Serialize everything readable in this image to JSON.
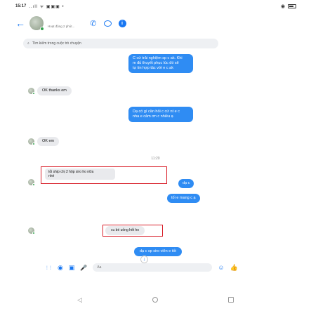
{
  "status_bar": {
    "time": "15:17",
    "signal": "..ıll ᯤ ▣▣▣ •"
  },
  "header": {
    "status": "Hoạt động 2 phút..."
  },
  "search": {
    "placeholder": "Tìm kiếm trong cuộc trò chuyện"
  },
  "messages": [
    {
      "id": "m1",
      "from": "me",
      "lines": [
        "C cứ trải nghiệm sp c ak. Khi",
        "m đủ thuyết phục lúc đó sẽ",
        "tự tin hợp tác với e c ak"
      ]
    },
    {
      "id": "m2",
      "from": "them",
      "text": "OK thanks em"
    },
    {
      "id": "m3",
      "from": "me",
      "lines": [
        "Dạ có gì cần hỏi c cứ nt e c",
        "nha e cảm ơn c nhiều ạ"
      ]
    },
    {
      "id": "m4",
      "from": "them",
      "text": "OK em"
    },
    {
      "id": "m5",
      "from": "them",
      "lines": [
        "tối ship chị 2 hộp siro ho nữa",
        "nhé"
      ],
      "highlighted": true
    },
    {
      "id": "m6",
      "from": "me",
      "text": "dạ c"
    },
    {
      "id": "m7",
      "from": "me",
      "text": "tối e mang c ạ"
    },
    {
      "id": "m8",
      "from": "them",
      "text": "cu bé uống hết ho",
      "highlighted": true
    },
    {
      "id": "m9",
      "from": "me",
      "text": "dạ c sp siro viên e tốt"
    }
  ],
  "timestamp": "11:20",
  "input": {
    "placeholder": "Aa"
  },
  "icons": {
    "back": "←",
    "call": "✆",
    "more": "⋮⋮",
    "camera": "◉",
    "image": "▣",
    "mic": "🎤",
    "emoji": "☺",
    "like": "👍",
    "down": "↓"
  },
  "colors": {
    "accent": "#1877f2",
    "bubble_out": "#2f8cf3",
    "bubble_in": "#e9eaed",
    "highlight": "#d9232d"
  }
}
